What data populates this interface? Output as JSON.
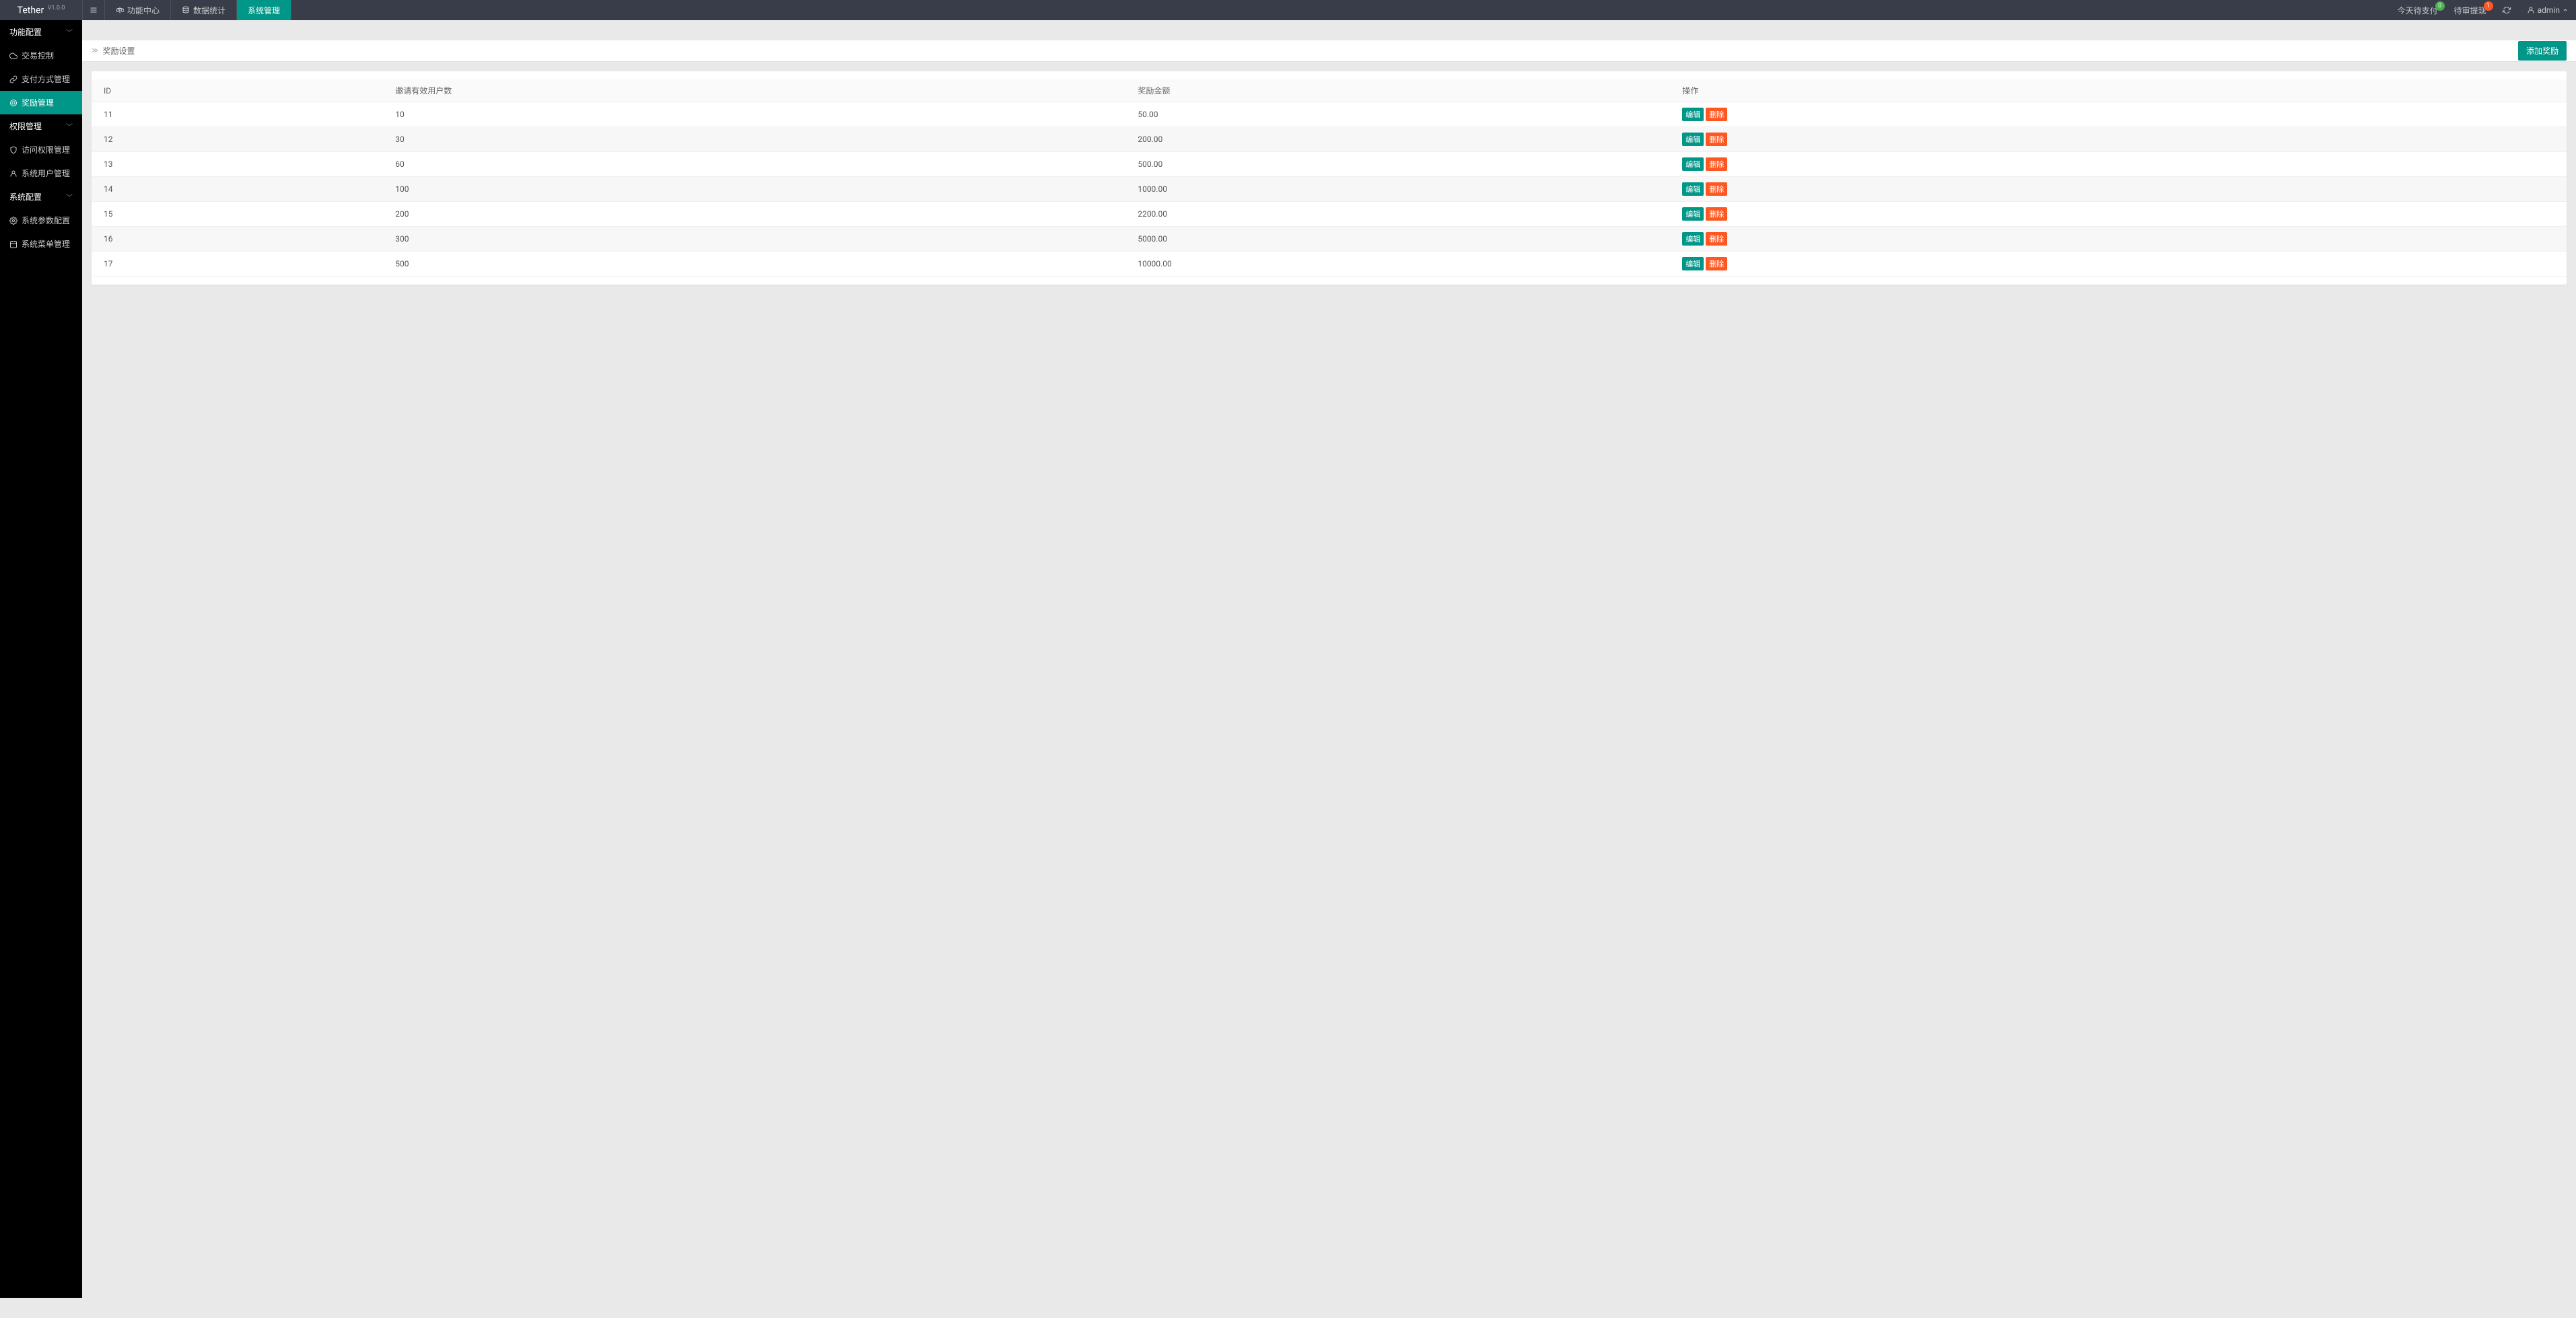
{
  "brand": {
    "name": "Tether",
    "version": "V1.0.0"
  },
  "topnav": {
    "items": [
      {
        "label": "功能中心",
        "icon": "scale-icon"
      },
      {
        "label": "数据统计",
        "icon": "database-icon"
      },
      {
        "label": "系统管理",
        "icon": null
      }
    ],
    "active_index": 2
  },
  "topright": {
    "pending_pay": {
      "label": "今天待支付",
      "count": "0"
    },
    "pending_review": {
      "label": "待审提现",
      "count": "1"
    },
    "user": "admin"
  },
  "sidebar": {
    "groups": [
      {
        "label": "功能配置",
        "items": [
          {
            "label": "交易控制",
            "icon": "cloud-icon"
          },
          {
            "label": "支付方式管理",
            "icon": "link-icon"
          },
          {
            "label": "奖励管理",
            "icon": "badge-icon",
            "active": true
          }
        ]
      },
      {
        "label": "权限管理",
        "items": [
          {
            "label": "访问权限管理",
            "icon": "shield-icon"
          },
          {
            "label": "系统用户管理",
            "icon": "user-icon"
          }
        ]
      },
      {
        "label": "系统配置",
        "items": [
          {
            "label": "系统参数配置",
            "icon": "gear-icon"
          },
          {
            "label": "系统菜单管理",
            "icon": "calendar-icon"
          }
        ]
      }
    ]
  },
  "breadcrumb": {
    "title": "奖励设置"
  },
  "actions": {
    "add": "添加奖励"
  },
  "table": {
    "headers": {
      "id": "ID",
      "users": "邀请有效用户数",
      "amount": "奖励金额",
      "ops": "操作"
    },
    "ops": {
      "edit": "编辑",
      "delete": "删除"
    },
    "rows": [
      {
        "id": "11",
        "users": "10",
        "amount": "50.00"
      },
      {
        "id": "12",
        "users": "30",
        "amount": "200.00"
      },
      {
        "id": "13",
        "users": "60",
        "amount": "500.00"
      },
      {
        "id": "14",
        "users": "100",
        "amount": "1000.00"
      },
      {
        "id": "15",
        "users": "200",
        "amount": "2200.00"
      },
      {
        "id": "16",
        "users": "300",
        "amount": "5000.00"
      },
      {
        "id": "17",
        "users": "500",
        "amount": "10000.00"
      }
    ]
  }
}
